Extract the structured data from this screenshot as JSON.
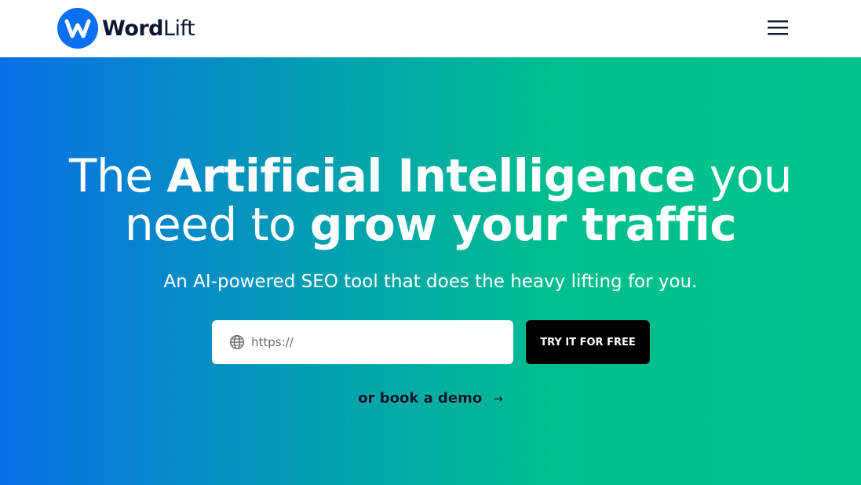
{
  "header": {
    "logo": {
      "letter": "W",
      "name_bold": "Word",
      "name_light": "Lift"
    },
    "menu_icon": "hamburger-menu-icon"
  },
  "hero": {
    "headline": {
      "line1_a": "The ",
      "line1_b": "Artificial Intelligence",
      "line1_c": " you",
      "line2_a": "need to ",
      "line2_b": "grow your traffic"
    },
    "subheadline": "An AI-powered SEO tool that does the heavy lifting for you.",
    "url_input": {
      "placeholder": "https://",
      "value": "",
      "icon": "globe-icon"
    },
    "cta_label": "TRY IT FOR FREE",
    "demo_label": "or book a demo",
    "demo_arrow": "→"
  },
  "colors": {
    "brand_blue": "#0a6ff1",
    "gradient_start": "#0a6fe6",
    "gradient_end": "#00c48a",
    "cta_background": "#000000"
  }
}
